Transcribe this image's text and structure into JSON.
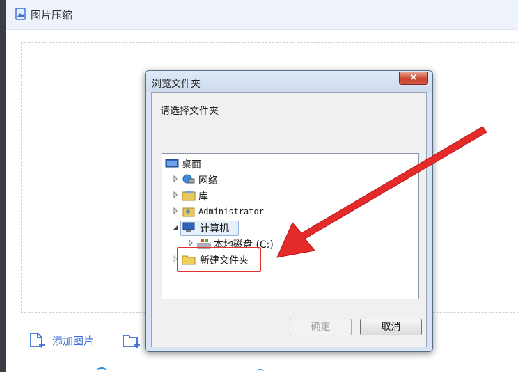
{
  "app": {
    "title": "图片压缩"
  },
  "toolbar": {
    "add_image_label": "添加图片"
  },
  "dialog": {
    "title": "浏览文件夹",
    "close_label": "×",
    "prompt": "请选择文件夹",
    "ok_label": "确定",
    "cancel_label": "取消",
    "tree": {
      "desktop": "桌面",
      "network": "网络",
      "library": "库",
      "admin": "Administrator",
      "computer": "计算机",
      "local_disk": "本地磁盘 (C:)",
      "new_folder": "新建文件夹"
    }
  },
  "colors": {
    "accent": "#3b6fd6",
    "annotation": "#e03232",
    "selection": "#e5f0fb"
  }
}
